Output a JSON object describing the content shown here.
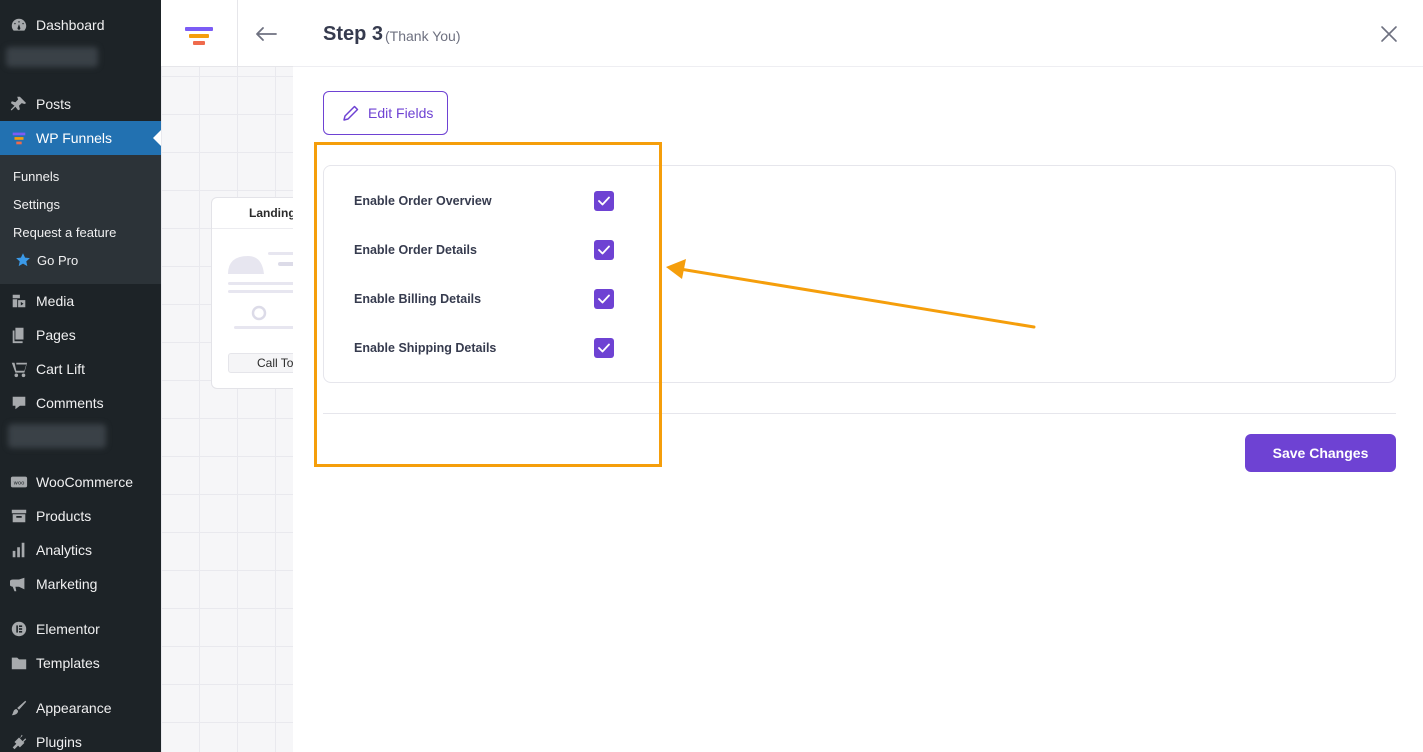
{
  "sidebar": {
    "items": [
      {
        "label": "Dashboard",
        "icon": "dashboard-icon"
      },
      {
        "label": "Posts",
        "icon": "pin-icon"
      },
      {
        "label": "WP Funnels",
        "icon": "funnel-icon"
      },
      {
        "label": "Media",
        "icon": "media-icon"
      },
      {
        "label": "Pages",
        "icon": "pages-icon"
      },
      {
        "label": "Cart Lift",
        "icon": "cart-icon"
      },
      {
        "label": "Comments",
        "icon": "comment-icon"
      },
      {
        "label": "WooCommerce",
        "icon": "woo-icon"
      },
      {
        "label": "Products",
        "icon": "archive-icon"
      },
      {
        "label": "Analytics",
        "icon": "bar-chart-icon"
      },
      {
        "label": "Marketing",
        "icon": "megaphone-icon"
      },
      {
        "label": "Elementor",
        "icon": "elementor-icon"
      },
      {
        "label": "Templates",
        "icon": "folder-icon"
      },
      {
        "label": "Appearance",
        "icon": "brush-icon"
      },
      {
        "label": "Plugins",
        "icon": "plug-icon"
      }
    ],
    "submenu": [
      "Funnels",
      "Settings",
      "Request a feature",
      "Go Pro"
    ]
  },
  "builder": {
    "node_title": "Landing",
    "node_cta": "Call To"
  },
  "panel": {
    "title": "Step 3",
    "subtitle": "(Thank You)",
    "edit_button": "Edit Fields",
    "options": [
      {
        "label": "Enable Order Overview",
        "checked": true
      },
      {
        "label": "Enable Order Details",
        "checked": true
      },
      {
        "label": "Enable Billing Details",
        "checked": true
      },
      {
        "label": "Enable Shipping Details",
        "checked": true
      }
    ],
    "save_button": "Save Changes"
  },
  "colors": {
    "accent": "#6e42d3",
    "annotation": "#f59e0b",
    "sidebar_bg": "#1d2327",
    "active_menu": "#2271b1"
  }
}
